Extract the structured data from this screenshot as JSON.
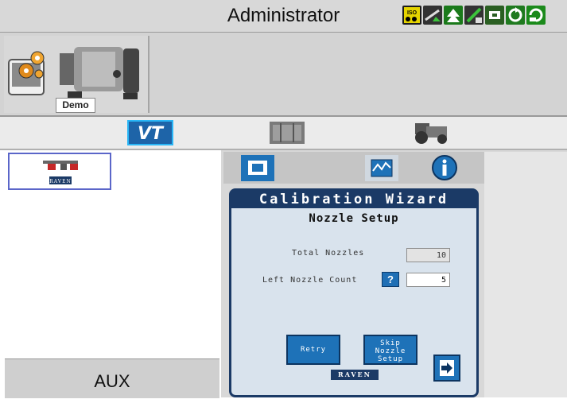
{
  "header": {
    "title": "Administrator"
  },
  "status_icons": [
    {
      "name": "iso-icon",
      "color": "#e5d400",
      "text": "ISO"
    },
    {
      "name": "gps-icon",
      "color": "#2e8b1f"
    },
    {
      "name": "nav-arrow-icon",
      "color": "#1b9a1b"
    },
    {
      "name": "signal-icon",
      "color": "#2e8b1f"
    },
    {
      "name": "connect-icon",
      "color": "#2b5f23"
    },
    {
      "name": "sync-icon",
      "color": "#2b9a2b"
    },
    {
      "name": "refresh-icon",
      "color": "#1f8b1f"
    }
  ],
  "machine": {
    "label": "Demo"
  },
  "tabs": [
    {
      "name": "tab-vt",
      "label": "VT"
    },
    {
      "name": "tab-map",
      "label": ""
    },
    {
      "name": "tab-machine",
      "label": ""
    }
  ],
  "implement": {
    "brand": "RAVEN"
  },
  "aux": {
    "label": "AUX"
  },
  "wizard": {
    "title": "Calibration Wizard",
    "subtitle": "Nozzle Setup",
    "total_nozzles_label": "Total Nozzles",
    "total_nozzles_value": "10",
    "left_nozzle_label": "Left Nozzle Count",
    "left_nozzle_value": "5",
    "help_label": "?",
    "retry_label": "Retry",
    "skip_label_line1": "Skip",
    "skip_label_line2": "Nozzle",
    "skip_label_line3": "Setup",
    "brand": "RAVEN"
  },
  "colors": {
    "accent_blue": "#1e72b8",
    "wizard_navy": "#1b3a66",
    "vt_cyan": "#29b6f6"
  }
}
